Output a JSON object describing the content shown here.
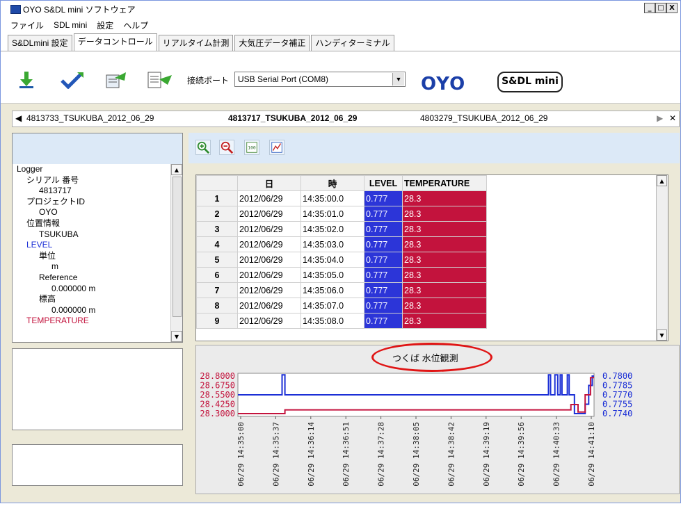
{
  "window": {
    "title": "OYO S&DL mini ソフトウェア",
    "buttons": [
      "_",
      "□",
      "X"
    ]
  },
  "menu": [
    "ファイル",
    "SDL mini",
    "設定",
    "ヘルプ"
  ],
  "main_tabs": [
    "S&DLmini 設定",
    "データコントロール",
    "リアルタイム計測",
    "大気圧データ補正",
    "ハンディターミナル"
  ],
  "toolbar": {
    "port_label": "接続ポート",
    "port_value": "USB Serial Port (COM8)",
    "logo_oyo": "OYO",
    "logo_sdl": "S&DL mini",
    "icons": [
      "download-icon",
      "check-arrow-icon",
      "import-icon",
      "export-icon"
    ]
  },
  "file_tabs": [
    "4813733_TSUKUBA_2012_06_29",
    "4813717_TSUKUBA_2012_06_29",
    "4803279_TSUKUBA_2012_06_29"
  ],
  "tree": [
    "Logger",
    "シリアル 番号",
    "4813717",
    "プロジェクトID",
    "OYO",
    "位置情報",
    "TSUKUBA",
    "LEVEL",
    "単位",
    "m",
    "Reference",
    "0.000000 m",
    "標高",
    "0.000000 m",
    "TEMPERATURE"
  ],
  "grid": {
    "columns": [
      "日",
      "時",
      "LEVEL",
      "TEMPERATURE"
    ],
    "rows": [
      [
        "1",
        "2012/06/29",
        "14:35:00.0",
        "0.777",
        "28.3"
      ],
      [
        "2",
        "2012/06/29",
        "14:35:01.0",
        "0.777",
        "28.3"
      ],
      [
        "3",
        "2012/06/29",
        "14:35:02.0",
        "0.777",
        "28.3"
      ],
      [
        "4",
        "2012/06/29",
        "14:35:03.0",
        "0.777",
        "28.3"
      ],
      [
        "5",
        "2012/06/29",
        "14:35:04.0",
        "0.777",
        "28.3"
      ],
      [
        "6",
        "2012/06/29",
        "14:35:05.0",
        "0.777",
        "28.3"
      ],
      [
        "7",
        "2012/06/29",
        "14:35:06.0",
        "0.777",
        "28.3"
      ],
      [
        "8",
        "2012/06/29",
        "14:35:07.0",
        "0.777",
        "28.3"
      ],
      [
        "9",
        "2012/06/29",
        "14:35:08.0",
        "0.777",
        "28.3"
      ]
    ]
  },
  "chart_data": {
    "type": "line",
    "title": "つくば 水位観測",
    "x": [
      "06/29 14:35:00",
      "06/29 14:35:37",
      "06/29 14:36:14",
      "06/29 14:36:51",
      "06/29 14:37:28",
      "06/29 14:38:05",
      "06/29 14:38:42",
      "06/29 14:39:19",
      "06/29 14:39:56",
      "06/29 14:40:33",
      "06/29 14:41:10"
    ],
    "yleft_ticks": [
      "28.8000",
      "28.6750",
      "28.5500",
      "28.4250",
      "28.3000"
    ],
    "yright_ticks": [
      "0.7800",
      "0.7785",
      "0.7770",
      "0.7755",
      "0.7740"
    ],
    "ylim_left": [
      28.3,
      28.8
    ],
    "ylim_right": [
      0.774,
      0.78
    ],
    "series": [
      {
        "color": "#1b2fd6",
        "points": [
          [
            0,
            0.777
          ],
          [
            0.124,
            0.777
          ],
          [
            0.124,
            0.7802
          ],
          [
            0.132,
            0.7802
          ],
          [
            0.132,
            0.777
          ],
          [
            0.872,
            0.777
          ],
          [
            0.872,
            0.7802
          ],
          [
            0.878,
            0.7802
          ],
          [
            0.878,
            0.777
          ],
          [
            0.89,
            0.777
          ],
          [
            0.89,
            0.7802
          ],
          [
            0.898,
            0.7802
          ],
          [
            0.898,
            0.777
          ],
          [
            0.905,
            0.777
          ],
          [
            0.905,
            0.7802
          ],
          [
            0.91,
            0.7802
          ],
          [
            0.91,
            0.777
          ],
          [
            0.925,
            0.777
          ],
          [
            0.925,
            0.7802
          ],
          [
            0.93,
            0.7802
          ],
          [
            0.93,
            0.777
          ],
          [
            0.945,
            0.777
          ],
          [
            0.945,
            0.774
          ],
          [
            0.975,
            0.774
          ],
          [
            0.975,
            0.7755
          ],
          [
            0.985,
            0.7755
          ],
          [
            0.985,
            0.7785
          ],
          [
            0.995,
            0.7785
          ],
          [
            0.995,
            0.78
          ],
          [
            1,
            0.78
          ]
        ]
      },
      {
        "color": "#c3133d",
        "points": [
          [
            0,
            28.3
          ],
          [
            0.132,
            28.3
          ],
          [
            0.132,
            28.35
          ],
          [
            0.935,
            28.35
          ],
          [
            0.935,
            28.42
          ],
          [
            0.955,
            28.42
          ],
          [
            0.955,
            28.32
          ],
          [
            0.975,
            28.32
          ],
          [
            0.975,
            28.55
          ],
          [
            0.99,
            28.55
          ],
          [
            0.99,
            28.78
          ],
          [
            1,
            28.78
          ]
        ]
      }
    ]
  },
  "colors": {
    "level": "#2c35d8",
    "temperature": "#c3133d",
    "accent": "#1b3fa8"
  }
}
